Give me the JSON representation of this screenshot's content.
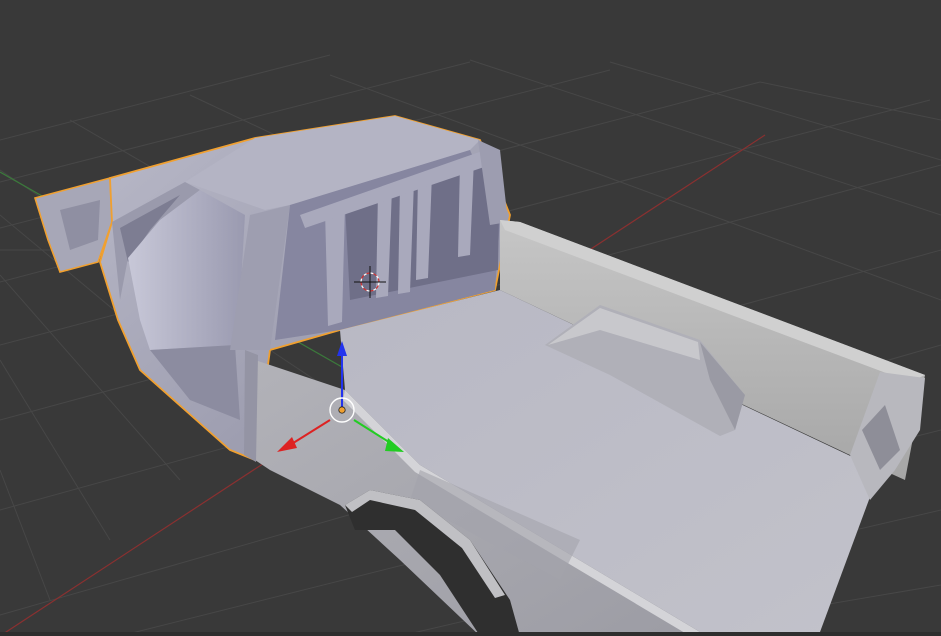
{
  "viewport": {
    "label": "",
    "background": "#393939",
    "grid_color": "#474747",
    "x_axis_color": "#8a3030",
    "y_axis_color": "#3b7a3b",
    "selection_outline_color": "#f0a030"
  },
  "object": {
    "name": "",
    "selected": true,
    "shading": "solid",
    "base_color": "#a8a8b8"
  },
  "gizmo": {
    "x_color": "#dd2222",
    "y_color": "#22cc22",
    "z_color": "#2233ee",
    "origin_color": "#f0a030"
  },
  "cursor_3d": {
    "visible": true,
    "icon": "3d-cursor-icon"
  }
}
